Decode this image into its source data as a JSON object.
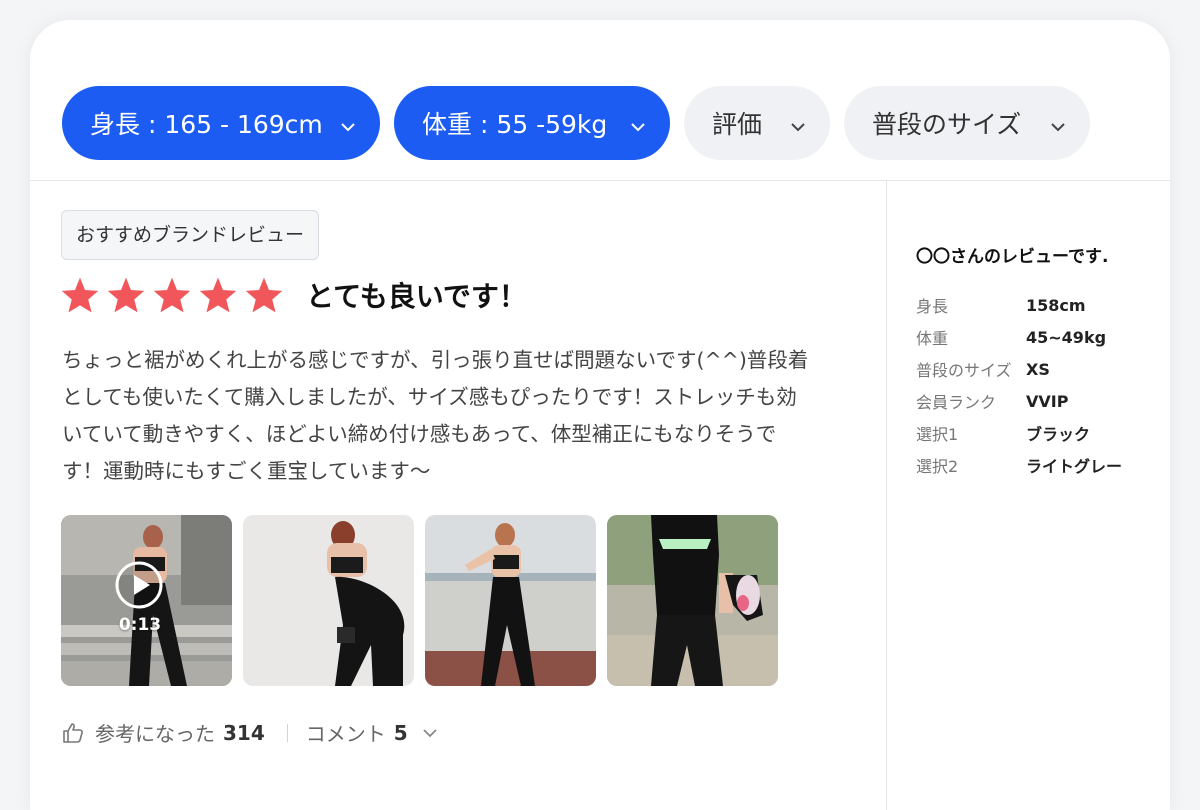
{
  "filters": [
    {
      "label": "身長 : 165 - 169cm",
      "active": true
    },
    {
      "label": "体重 : 55 -59kg",
      "active": true
    },
    {
      "label": "評価",
      "active": false
    },
    {
      "label": "普段のサイズ",
      "active": false
    }
  ],
  "review": {
    "badge": "おすすめブランドレビュー",
    "rating": 5,
    "title": "とても良いです！",
    "body_lines": [
      "ちょっと裾がめくれ上がる感じですが、引っ張り直せば問題ないです(^^)普段着",
      "としても使いたくて購入しましたが、サイズ感もぴったりです！ストレッチも効",
      "いていて動きやすく、ほどよい締め付け感もあって、体型補正にもなりそうで",
      "す！運動時にもすごく重宝しています〜"
    ],
    "video_duration": "0:13",
    "helpful_label": "参考になった",
    "helpful_count": "314",
    "comment_label": "コメント",
    "comment_count": "5"
  },
  "reviewer": {
    "title": "〇〇さんのレビューです.",
    "rows": [
      {
        "label": "身長",
        "value": "158cm"
      },
      {
        "label": "体重",
        "value": "45~49kg"
      },
      {
        "label": "普段のサイズ",
        "value": "XS"
      },
      {
        "label": "会員ランク",
        "value": "VVIP"
      },
      {
        "label": "選択1",
        "value": "ブラック"
      },
      {
        "label": "選択2",
        "value": "ライトグレー"
      }
    ]
  },
  "colors": {
    "accent": "#1c5cf2",
    "star": "#f0565a",
    "chip_inactive": "#f0f1f4"
  },
  "icons": [
    "chevron-down-icon",
    "star-icon",
    "play-icon",
    "thumbs-up-icon"
  ]
}
